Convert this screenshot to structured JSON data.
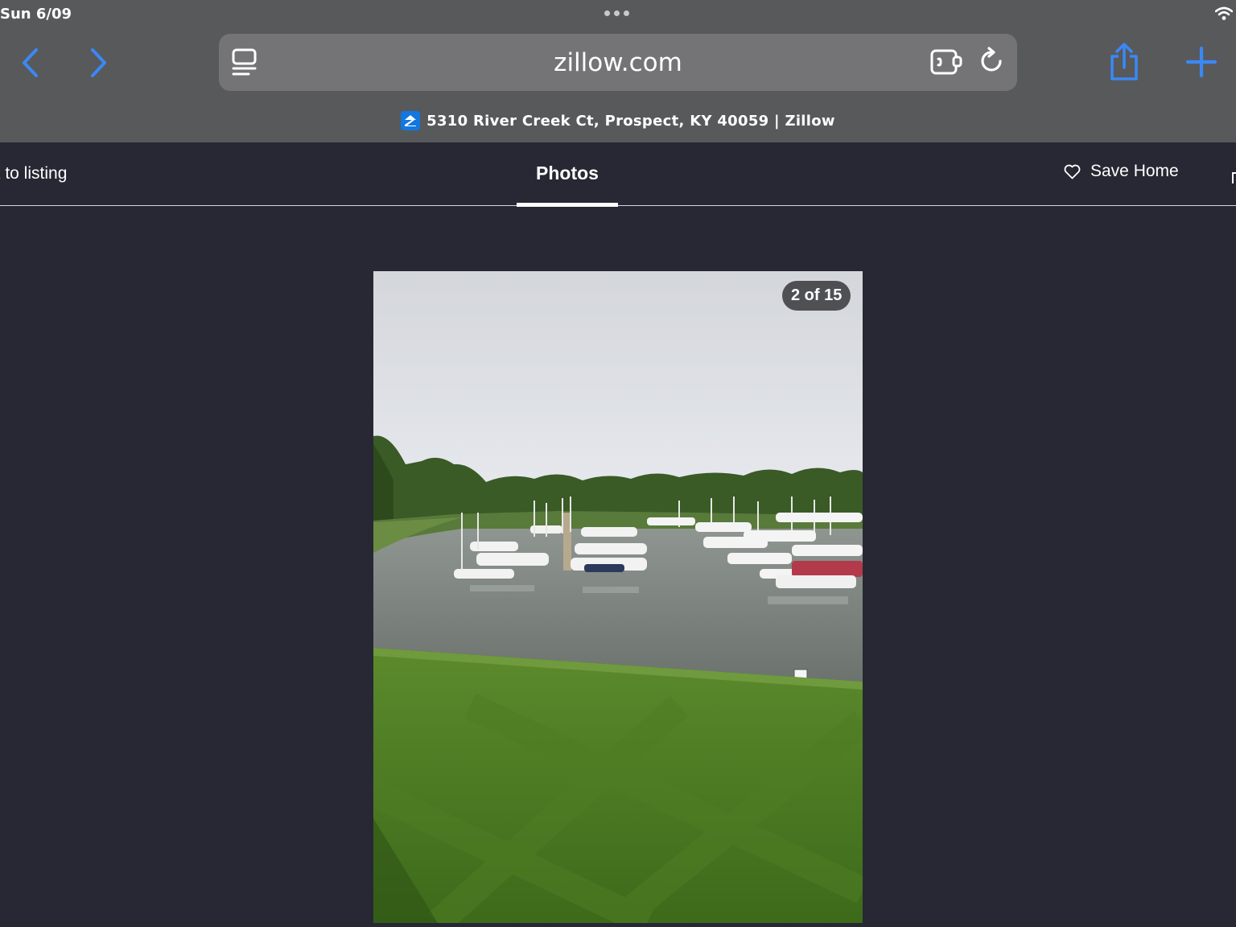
{
  "status_bar": {
    "time": "Sun 6/09"
  },
  "browser": {
    "url": "zillow.com",
    "tab_title": "5310 River Creek Ct, Prospect, KY 40059 | Zillow",
    "icons": {
      "back": "chevron-left-icon",
      "forward": "chevron-right-icon",
      "reader": "reader-mode-icon",
      "extension": "extension-icon",
      "reload": "reload-icon",
      "share": "share-icon",
      "new_tab": "plus-icon"
    },
    "accent_color": "#2f7ff0"
  },
  "header": {
    "back_label": "k to listing",
    "tab_label": "Photos",
    "save_label": "Save Home"
  },
  "gallery": {
    "counter": "2 of 15",
    "photo_subject": "marina with boats and mowed lawn"
  }
}
